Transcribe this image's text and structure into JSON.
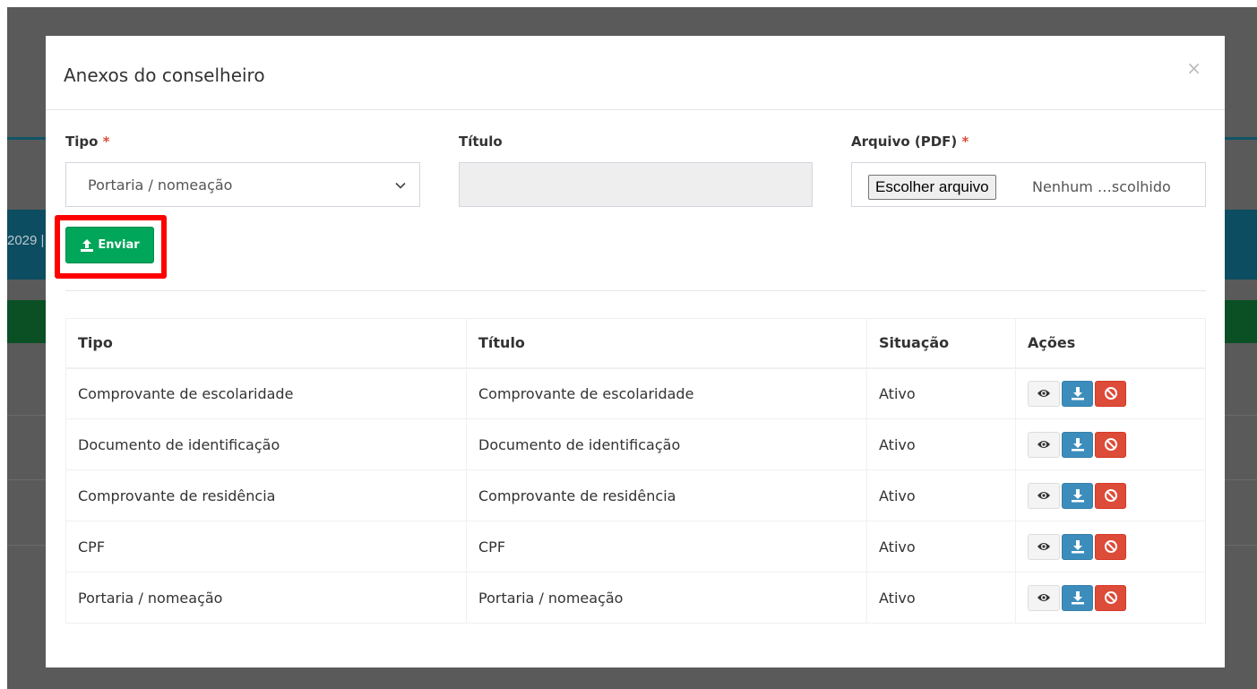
{
  "backdrop": {
    "partial_text": "2029 |"
  },
  "modal": {
    "title": "Anexos do conselheiro",
    "close": "×"
  },
  "form": {
    "tipo_label": "Tipo",
    "titulo_label": "Título",
    "arquivo_label": "Arquivo (PDF)",
    "required_mark": "*",
    "tipo_selected": "Portaria / nomeação",
    "titulo_value": "",
    "file_button": "Escolher arquivo",
    "file_name": "Nenhum …scolhido",
    "submit_label": "Enviar"
  },
  "table": {
    "headers": [
      "Tipo",
      "Título",
      "Situação",
      "Ações"
    ],
    "rows": [
      {
        "tipo": "Comprovante de escolaridade",
        "titulo": "Comprovante de escolaridade",
        "situacao": "Ativo"
      },
      {
        "tipo": "Documento de identificação",
        "titulo": "Documento de identificação",
        "situacao": "Ativo"
      },
      {
        "tipo": "Comprovante de residência",
        "titulo": "Comprovante de residência",
        "situacao": "Ativo"
      },
      {
        "tipo": "CPF",
        "titulo": "CPF",
        "situacao": "Ativo"
      },
      {
        "tipo": "Portaria / nomeação",
        "titulo": "Portaria / nomeação",
        "situacao": "Ativo"
      }
    ]
  },
  "icons": {
    "upload": "upload-icon",
    "view": "eye-icon",
    "download": "download-icon",
    "delete": "ban-icon",
    "select": "chevron-down-icon"
  },
  "colors": {
    "success": "#00a65a",
    "primary": "#3c8dbc",
    "danger": "#dd4b39",
    "highlight": "#ff0000"
  }
}
